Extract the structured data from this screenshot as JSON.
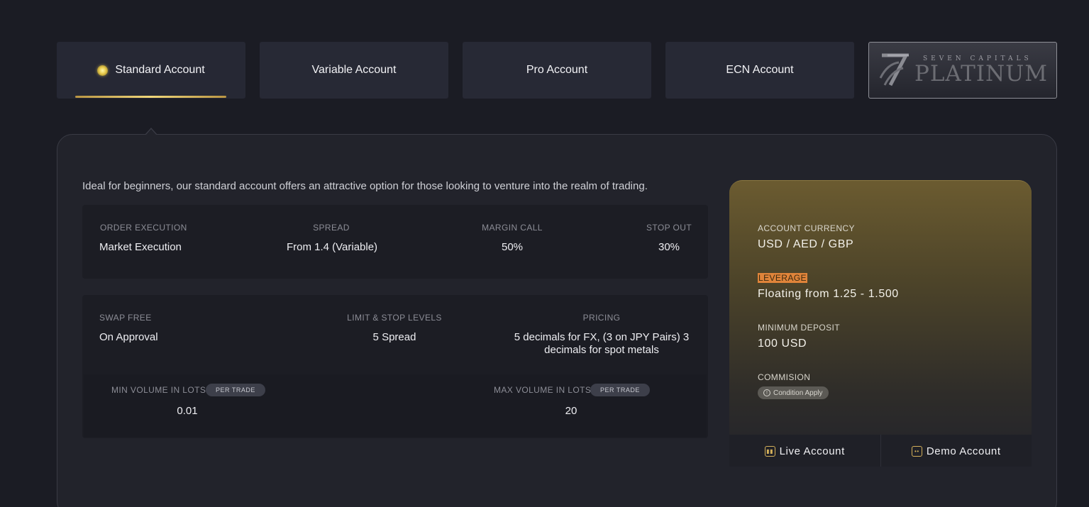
{
  "tabs": [
    {
      "label": "Standard Account"
    },
    {
      "label": "Variable Account"
    },
    {
      "label": "Pro Account"
    },
    {
      "label": "ECN Account"
    }
  ],
  "platinum_logo": {
    "small": "SEVEN CAPITALS",
    "big": "PLATINUM"
  },
  "intro": "Ideal for beginners, our standard account offers an attractive option for those looking to venture into the realm of trading.",
  "specs": {
    "order_execution": {
      "label": "ORDER EXECUTION",
      "value": "Market Execution"
    },
    "spread": {
      "label": "SPREAD",
      "value": "From 1.4 (Variable)"
    },
    "margin_call": {
      "label": "MARGIN CALL",
      "value": "50%"
    },
    "stop_out": {
      "label": "STOP OUT",
      "value": "30%"
    },
    "swap_free": {
      "label": "SWAP FREE",
      "value": "On Approval"
    },
    "limit_stop": {
      "label": "LIMIT & STOP LEVELS",
      "value": "5 Spread"
    },
    "pricing": {
      "label": "PRICING",
      "value_line1": "5 decimals for FX, (3 on JPY Pairs) 3",
      "value_line2": "decimals for spot metals"
    },
    "min_volume": {
      "label": "MIN VOLUME IN LOTS",
      "badge": "PER TRADE",
      "value": "0.01"
    },
    "max_volume": {
      "label": "MAX VOLUME IN LOTS",
      "badge": "PER TRADE",
      "value": "20"
    }
  },
  "card": {
    "currency": {
      "label": "ACCOUNT CURRENCY",
      "value": "USD / AED / GBP"
    },
    "leverage": {
      "label": "LEVERAGE",
      "value": "Floating from 1.25 - 1.500"
    },
    "min_deposit": {
      "label": "MINIMUM DEPOSIT",
      "value": "100 USD"
    },
    "commission": {
      "label": "COMMISION",
      "badge": "Condition Apply"
    },
    "live_button": "Live Account",
    "demo_button": "Demo Account"
  },
  "colors": {
    "background": "#1b1c24",
    "accent_gold": "#e7c94a",
    "highlight": "#e0843a"
  }
}
